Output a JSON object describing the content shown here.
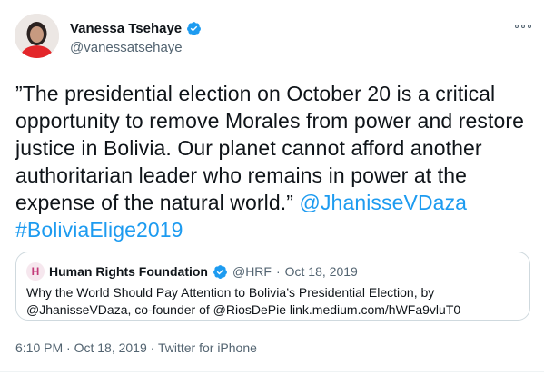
{
  "author": {
    "name": "Vanessa Tsehaye",
    "handle": "@vanessatsehaye",
    "avatar": "avatar-photo"
  },
  "tweet": {
    "text": "”The presidential election on October 20 is a critical opportunity to remove Morales from power and restore justice in Bolivia. Our planet cannot afford another authoritarian leader who remains in power at the expense of the natural world.” ",
    "mention": "@JhanisseVDaza",
    "hashtag": "#BoliviaElige2019"
  },
  "quoted": {
    "logo_letter": "H",
    "name": "Human Rights Foundation",
    "handle": "@HRF",
    "separator": "·",
    "date": "Oct 18, 2019",
    "text": "Why the World Should Pay Attention to Bolivia’s Presidential Election, by @JhanisseVDaza, co-founder of @RiosDePie link.medium.com/hWFa9vluT0"
  },
  "footer": {
    "time": "6:10 PM",
    "separator": "·",
    "date": "Oct 18, 2019",
    "source": "Twitter for iPhone"
  },
  "colors": {
    "link": "#1d9bf0",
    "verified": "#1d9bf0",
    "secondary_text": "#536471",
    "border": "#cfd9de"
  },
  "icons": {
    "verified": "verified-badge-icon",
    "more": "more-options-icon"
  }
}
